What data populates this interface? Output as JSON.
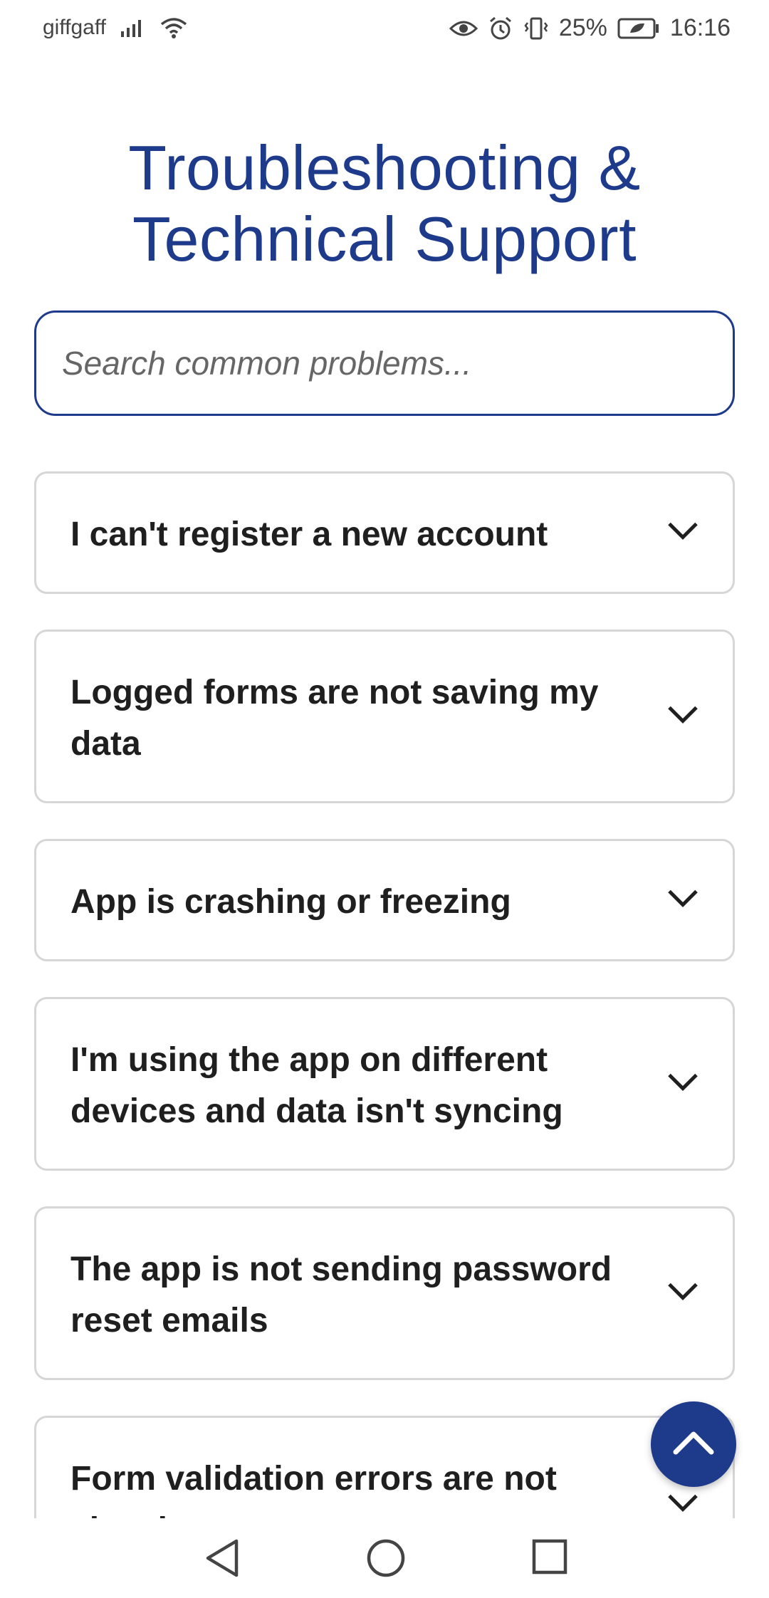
{
  "status_bar": {
    "carrier": "giffgaff",
    "battery_percent": "25%",
    "time": "16:16",
    "icons": [
      "signal-icon",
      "wifi-icon",
      "eye-icon",
      "alarm-icon",
      "vibrate-icon",
      "battery-icon"
    ]
  },
  "page": {
    "title_line1": "Troubleshooting &",
    "title_line2": "Technical Support"
  },
  "search": {
    "placeholder": "Search common problems..."
  },
  "faq": [
    {
      "question": "I can't register a new account"
    },
    {
      "question": "Logged forms are not saving my data"
    },
    {
      "question": "App is crashing or freezing"
    },
    {
      "question": "I'm using the app on different devices and data isn't syncing"
    },
    {
      "question": "The app is not sending password reset emails"
    },
    {
      "question": "Form validation errors are not showing"
    }
  ],
  "colors": {
    "accent": "#1e3a8a",
    "card_border": "#d6d6d6",
    "text": "#1f1f1f"
  }
}
